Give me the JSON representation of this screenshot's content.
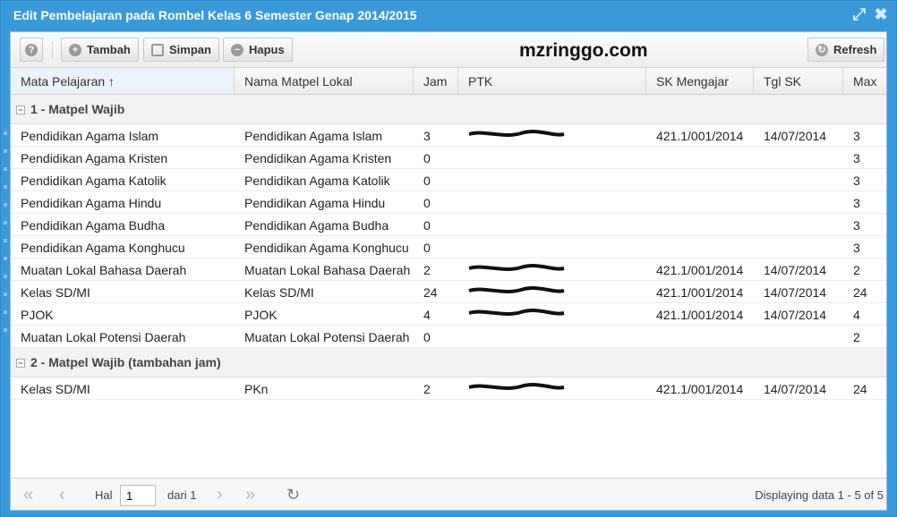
{
  "window": {
    "title": "Edit Pembelajaran pada Rombel Kelas 6 Semester Genap 2014/2015",
    "watermark": "mzringgo.com"
  },
  "toolbar": {
    "help_icon": "?",
    "add_label": "Tambah",
    "save_label": "Simpan",
    "delete_label": "Hapus",
    "refresh_label": "Refresh"
  },
  "columns": [
    {
      "label": "Mata Pelajaran ↑"
    },
    {
      "label": "Nama Matpel Lokal"
    },
    {
      "label": "Jam"
    },
    {
      "label": "PTK"
    },
    {
      "label": "SK Mengajar"
    },
    {
      "label": "Tgl SK"
    },
    {
      "label": "Max"
    }
  ],
  "groups": [
    {
      "label": "1 - Matpel Wajib",
      "rows": [
        {
          "mapel": "Pendidikan Agama Islam",
          "lokal": "Pendidikan Agama Islam",
          "jam": "3",
          "ptk_redacted": true,
          "sk": "421.1/001/2014",
          "tgl": "14/07/2014",
          "max": "3"
        },
        {
          "mapel": "Pendidikan Agama Kristen",
          "lokal": "Pendidikan Agama Kristen",
          "jam": "0",
          "ptk_redacted": false,
          "sk": "",
          "tgl": "",
          "max": "3"
        },
        {
          "mapel": "Pendidikan Agama Katolik",
          "lokal": "Pendidikan Agama Katolik",
          "jam": "0",
          "ptk_redacted": false,
          "sk": "",
          "tgl": "",
          "max": "3"
        },
        {
          "mapel": "Pendidikan Agama Hindu",
          "lokal": "Pendidikan Agama Hindu",
          "jam": "0",
          "ptk_redacted": false,
          "sk": "",
          "tgl": "",
          "max": "3"
        },
        {
          "mapel": "Pendidikan Agama Budha",
          "lokal": "Pendidikan Agama Budha",
          "jam": "0",
          "ptk_redacted": false,
          "sk": "",
          "tgl": "",
          "max": "3"
        },
        {
          "mapel": "Pendidikan Agama Konghucu",
          "lokal": "Pendidikan Agama Konghucu",
          "jam": "0",
          "ptk_redacted": false,
          "sk": "",
          "tgl": "",
          "max": "3"
        },
        {
          "mapel": "Muatan Lokal Bahasa Daerah",
          "lokal": "Muatan Lokal Bahasa Daerah",
          "jam": "2",
          "ptk_redacted": true,
          "sk": "421.1/001/2014",
          "tgl": "14/07/2014",
          "max": "2"
        },
        {
          "mapel": "Kelas SD/MI",
          "lokal": "Kelas SD/MI",
          "jam": "24",
          "ptk_redacted": true,
          "sk": "421.1/001/2014",
          "tgl": "14/07/2014",
          "max": "24"
        },
        {
          "mapel": "PJOK",
          "lokal": "PJOK",
          "jam": "4",
          "ptk_redacted": true,
          "sk": "421.1/001/2014",
          "tgl": "14/07/2014",
          "max": "4"
        },
        {
          "mapel": "Muatan Lokal Potensi Daerah",
          "lokal": "Muatan Lokal Potensi Daerah",
          "jam": "0",
          "ptk_redacted": false,
          "sk": "",
          "tgl": "",
          "max": "2"
        }
      ]
    },
    {
      "label": "2 - Matpel Wajib (tambahan jam)",
      "rows": [
        {
          "mapel": "Kelas SD/MI",
          "lokal": "PKn",
          "jam": "2",
          "ptk_redacted": true,
          "sk": "421.1/001/2014",
          "tgl": "14/07/2014",
          "max": "24"
        }
      ]
    }
  ],
  "pager": {
    "page_label": "Hal",
    "page_value": "1",
    "of_label": "dari 1",
    "displaying": "Displaying data 1 - 5 of 5"
  },
  "colors": {
    "window_frame": "#3a9ad9",
    "header_sorted": "#eaf3fb"
  }
}
